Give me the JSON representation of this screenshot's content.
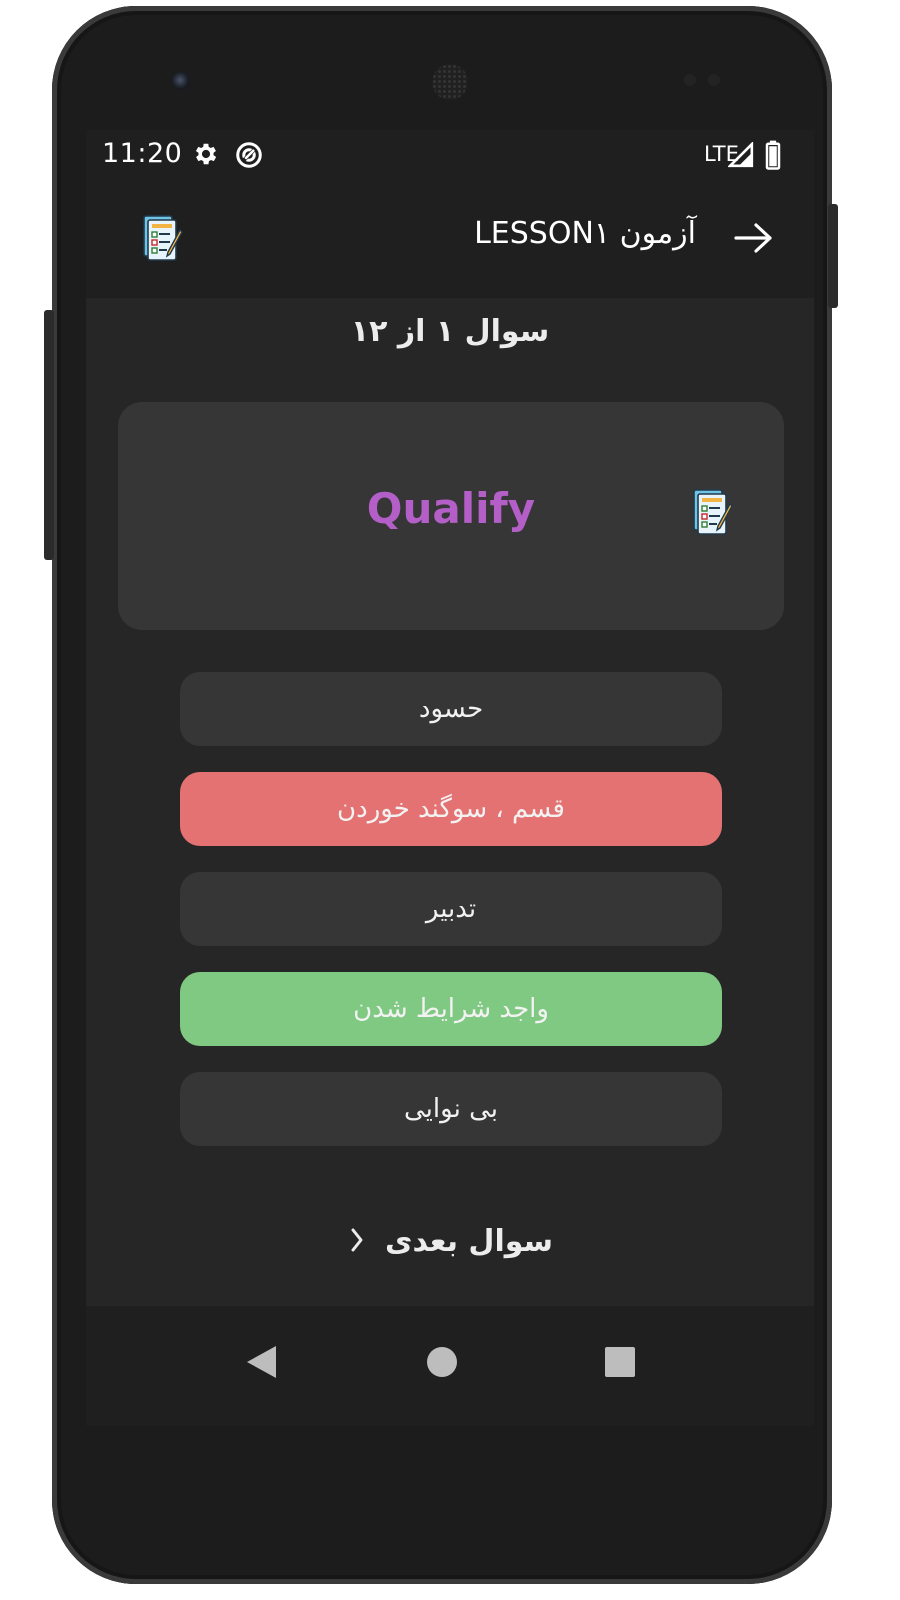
{
  "status_bar": {
    "time": "11:20",
    "icons": [
      "gear-icon",
      "sync-icon"
    ],
    "network": "LTE",
    "signal_icon": "signal-icon",
    "battery_icon": "battery-icon"
  },
  "app_bar": {
    "title": "آزمون LESSON۱",
    "back_icon": "arrow-right-icon",
    "logo_icon": "quiz-clipboard-icon"
  },
  "quiz": {
    "progress": "سوال ۱ از ۱۲",
    "question_word": "Qualify",
    "question_word_color": "#b45fc7",
    "options": [
      {
        "label": "حسود",
        "state": "neutral"
      },
      {
        "label": "قسم ، سوگند خوردن",
        "state": "wrong"
      },
      {
        "label": "تدبیر",
        "state": "neutral"
      },
      {
        "label": "واجد شرایط شدن",
        "state": "correct"
      },
      {
        "label": "بی نوایی",
        "state": "neutral"
      }
    ],
    "next_label": "سوال بعدی",
    "next_icon": "chevron-left-icon"
  },
  "colors": {
    "wrong": "#e47272",
    "correct": "#80c983",
    "option_bg": "#363636"
  },
  "nav_bar": {
    "back_icon": "nav-back-icon",
    "home_icon": "nav-home-icon",
    "recents_icon": "nav-recents-icon"
  }
}
